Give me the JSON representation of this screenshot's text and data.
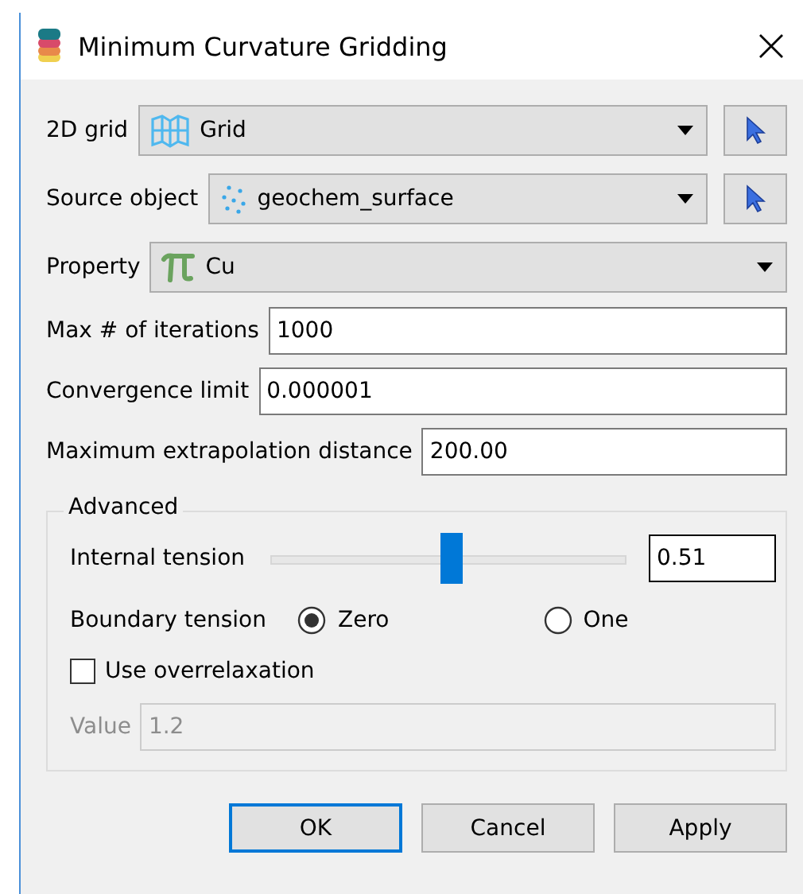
{
  "window": {
    "title": "Minimum Curvature Gridding"
  },
  "selectors": [
    {
      "label": "2D grid",
      "value": "Grid",
      "has_picker": true
    },
    {
      "label": "Source object",
      "value": "geochem_surface",
      "has_picker": true
    },
    {
      "label": "Property",
      "value": "Cu",
      "has_picker": false
    }
  ],
  "fields": [
    {
      "label": "Max # of iterations",
      "value": "1000"
    },
    {
      "label": "Convergence limit",
      "value": "0.000001"
    },
    {
      "label": "Maximum extrapolation distance",
      "value": "200.00"
    }
  ],
  "advanced": {
    "title": "Advanced",
    "internal_tension": {
      "label": "Internal tension",
      "level": 0.51,
      "reading": "0.51"
    },
    "boundary_tension": {
      "label": "Boundary tension",
      "options": [
        {
          "label": "Zero",
          "selected": true
        },
        {
          "label": "One",
          "selected": false
        }
      ]
    },
    "overrelaxation": {
      "label": "Use overrelaxation",
      "checked": false
    },
    "value_field": {
      "label": "Value",
      "value": "1.2",
      "disabled": true
    }
  },
  "buttons": [
    {
      "label": "OK",
      "default": true
    },
    {
      "label": "Cancel",
      "default": false
    },
    {
      "label": "Apply",
      "default": false
    }
  ]
}
